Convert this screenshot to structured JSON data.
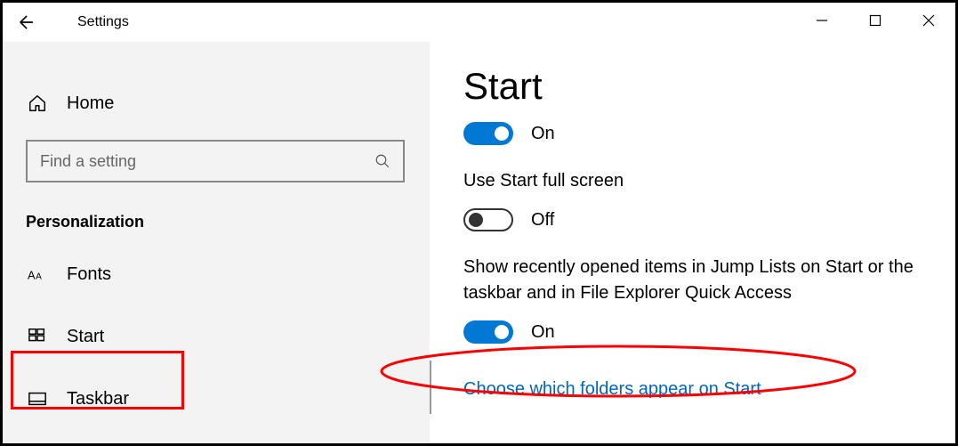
{
  "window": {
    "title": "Settings"
  },
  "sidebar": {
    "home_label": "Home",
    "search_placeholder": "Find a setting",
    "section_heading": "Personalization",
    "items": [
      {
        "label": "Fonts"
      },
      {
        "label": "Start"
      },
      {
        "label": "Taskbar"
      }
    ]
  },
  "main": {
    "page_title": "Start",
    "toggle1_state": "On",
    "setting2_label": "Use Start full screen",
    "toggle2_state": "Off",
    "setting3_label": "Show recently opened items in Jump Lists on Start or the taskbar and in File Explorer Quick Access",
    "toggle3_state": "On",
    "link_label": "Choose which folders appear on Start"
  }
}
